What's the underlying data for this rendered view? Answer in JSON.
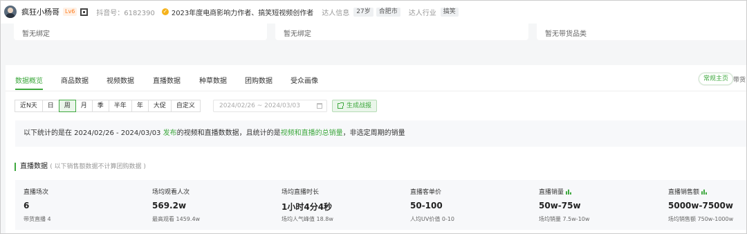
{
  "header": {
    "username": "疯狂小杨哥",
    "level": "Lv6",
    "douyin_id": "抖音号：6182390",
    "honor": "2023年度电商影响力作者、搞笑短视频创作者",
    "influencer_info_label": "达人信息",
    "age": "27岁",
    "city": "合肥市",
    "industry_label": "达人行业",
    "industry": "搞笑"
  },
  "bind_cards": [
    {
      "text": "暂无绑定"
    },
    {
      "text": "暂无绑定"
    },
    {
      "text": "暂无带货品类"
    }
  ],
  "tabs": [
    {
      "label": "数据概览",
      "active": true
    },
    {
      "label": "商品数据"
    },
    {
      "label": "视频数据"
    },
    {
      "label": "直播数据"
    },
    {
      "label": "种草数据"
    },
    {
      "label": "团购数据"
    },
    {
      "label": "受众画像"
    }
  ],
  "mode_switch": {
    "active": "常规主页",
    "other": "带货"
  },
  "filters": [
    "近N天",
    "日",
    "周",
    "月",
    "季",
    "半年",
    "年",
    "大促",
    "自定义"
  ],
  "active_filter": "周",
  "date_range": "2024/02/26 ~ 2024/03/03",
  "generate_button": "生成战报",
  "notice": {
    "p1": "以下统计的是在 2024/02/26 - 2024/03/03 ",
    "p2": "发布",
    "p3": "的视频和直播数数据，且统计的是",
    "p4": "视频和直播的总销量",
    "p5": "，非选定周期的销量"
  },
  "section": {
    "title": "直播数据",
    "note": "( 以下销售额数据不计算团购数据 )"
  },
  "stats": [
    {
      "label": "直播场次",
      "value": "6",
      "sub": "带货直播 4"
    },
    {
      "label": "场均观看人次",
      "value": "569.2w",
      "sub": "最高观看 1459.4w"
    },
    {
      "label": "场均直播时长",
      "value": "1小时4分4秒",
      "sub": "场均人气峰值 18.8w"
    },
    {
      "label": "直播客单价",
      "value": "50-100",
      "sub": "人均UV价值 0-10"
    },
    {
      "label": "直播销量",
      "value": "50w-75w",
      "sub": "场均销量 7.5w-10w",
      "chart_icon": "bar-chart-icon"
    },
    {
      "label": "直播销售额",
      "value": "5000w-7500w",
      "sub": "场均销售额 750w-1000w",
      "chart_icon": "bar-chart-icon"
    }
  ],
  "colors": {
    "accent": "#3ea83e",
    "level": "#ff7a1a",
    "honor_badge": "#f5b21b"
  }
}
